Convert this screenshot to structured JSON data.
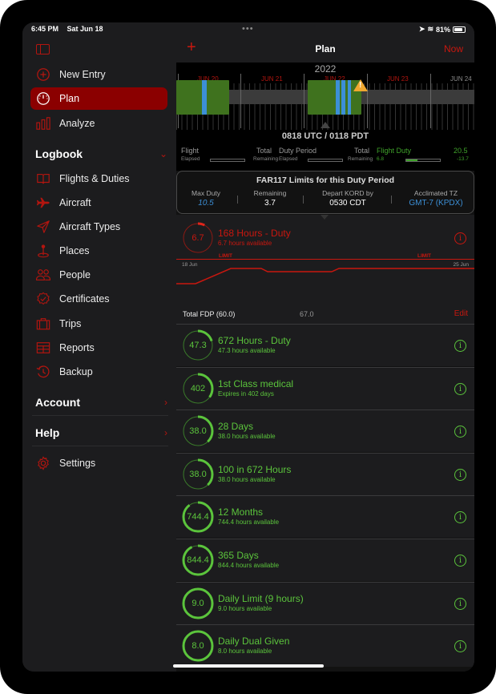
{
  "status_bar": {
    "time": "6:45 PM",
    "date": "Sat Jun 18",
    "battery": "81%",
    "battery_level": 0.81
  },
  "sidebar": {
    "top_items": [
      {
        "label": "New Entry",
        "icon": "plus-circle-icon"
      },
      {
        "label": "Plan",
        "icon": "gauge-icon",
        "active": true
      },
      {
        "label": "Analyze",
        "icon": "bar-chart-icon"
      }
    ],
    "logbook": {
      "title": "Logbook",
      "items": [
        {
          "label": "Flights & Duties",
          "icon": "book-icon"
        },
        {
          "label": "Aircraft",
          "icon": "airplane-icon"
        },
        {
          "label": "Aircraft Types",
          "icon": "paper-plane-icon"
        },
        {
          "label": "Places",
          "icon": "map-pin-icon"
        },
        {
          "label": "People",
          "icon": "people-icon"
        },
        {
          "label": "Certificates",
          "icon": "certificate-badge-icon"
        },
        {
          "label": "Trips",
          "icon": "suitcase-icon"
        },
        {
          "label": "Reports",
          "icon": "table-icon"
        },
        {
          "label": "Backup",
          "icon": "history-icon"
        }
      ]
    },
    "account": "Account",
    "help": "Help",
    "settings": "Settings"
  },
  "header": {
    "title": "Plan",
    "now_button": "Now",
    "add_icon": "plus-icon"
  },
  "timeline": {
    "year": "2022",
    "days": [
      "JUN 20",
      "JUN 21",
      "JUN 22",
      "JUN 23",
      "JUN 24"
    ],
    "current_time": "0818 UTC / 0118 PDT",
    "warning_icon": "warning-triangle-icon"
  },
  "duty_summary": {
    "flight": {
      "label": "Flight",
      "sub_left": "Elapsed",
      "total": "Total",
      "sub_right": "Remaining"
    },
    "duty_period": {
      "label": "Duty Period",
      "sub_left": "Elapsed",
      "total": "Total",
      "sub_right": "Remaining"
    },
    "flight_duty": {
      "label": "Flight Duty",
      "elapsed": "6.8",
      "total": "20.5",
      "remaining": "-13.7",
      "progress": 0.33
    }
  },
  "far117": {
    "title": "FAR117 Limits for this Duty Period",
    "columns": [
      {
        "label": "Max Duty",
        "value": "10.5"
      },
      {
        "label": "Remaining",
        "value": "3.7"
      },
      {
        "label": "Depart KORD by",
        "value": "0530 CDT"
      },
      {
        "label": "Acclimated TZ",
        "value": "GMT-7 (KPDX)"
      }
    ]
  },
  "duty_limit_chart": {
    "title": "168 Hours - Duty",
    "value": "6.7",
    "subtitle": "6.7 hours available",
    "fraction": 0.04,
    "limit_label": "LIMIT",
    "start_label": "18 Jun",
    "end_label": "25 Jun",
    "fdp_label": "Total FDP (60.0)",
    "fdp_value": "67.0",
    "edit_label": "Edit"
  },
  "limits": [
    {
      "value": "47.3",
      "title": "672 Hours - Duty",
      "subtitle": "47.3 hours available",
      "fraction": 0.2
    },
    {
      "value": "402",
      "title": "1st Class medical",
      "subtitle": "Expires in 402 days",
      "fraction": 0.35
    },
    {
      "value": "38.0",
      "title": "28 Days",
      "subtitle": "38.0 hours available",
      "fraction": 0.38
    },
    {
      "value": "38.0",
      "title": "100 in 672 Hours",
      "subtitle": "38.0 hours available",
      "fraction": 0.38
    },
    {
      "value": "744.4",
      "title": "12 Months",
      "subtitle": "744.4 hours available",
      "fraction": 0.9
    },
    {
      "value": "844.4",
      "title": "365 Days",
      "subtitle": "844.4 hours available",
      "fraction": 0.93
    },
    {
      "value": "9.0",
      "title": "Daily Limit (9 hours)",
      "subtitle": "9.0 hours available",
      "fraction": 1.0
    },
    {
      "value": "8.0",
      "title": "Daily Dual Given",
      "subtitle": "8.0 hours available",
      "fraction": 1.0
    }
  ],
  "colors": {
    "accent_red": "#c8170f",
    "ok_green": "#5bc43c",
    "flight_green": "#3f721e",
    "flight_blue": "#3c8fd6",
    "warning": "#f0a830"
  }
}
